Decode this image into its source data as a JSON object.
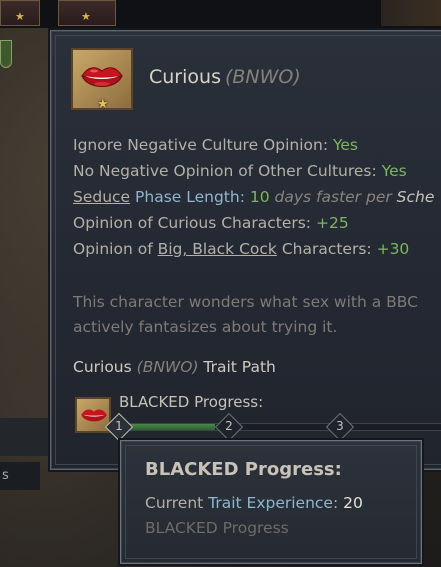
{
  "background": {
    "side_chip_text": "s"
  },
  "trait": {
    "name": "Curious",
    "tag": "(BNWO)",
    "icon": "lips-icon"
  },
  "effects": [
    {
      "label": "Ignore Negative Culture Opinion: ",
      "value": "Yes"
    },
    {
      "label": "No Negative Opinion of Other Cultures: ",
      "value": "Yes"
    }
  ],
  "seduce_line": {
    "link": "Seduce",
    "label": " Phase Length: ",
    "value": "10",
    "tail": " days faster per ",
    "tail2": "Sche"
  },
  "opinion_curious": {
    "label": "Opinion of Curious Characters: ",
    "value": "+25"
  },
  "opinion_bbc": {
    "prefix": "Opinion of ",
    "link": "Big, Black Cock",
    "suffix": " Characters: ",
    "value": "+30"
  },
  "description": {
    "line1": "This character wonders what sex with a BBC",
    "line2": "actively fantasizes about trying it."
  },
  "trait_path": {
    "name": "Curious ",
    "tag": "(BNWO)",
    "suffix": " Trait Path"
  },
  "progress": {
    "label": "BLACKED Progress:",
    "fraction": 0.3,
    "markers": [
      "1",
      "2",
      "3"
    ]
  },
  "tooltip": {
    "title": "BLACKED Progress:",
    "exp_label_a": "Current ",
    "exp_label_b": "Trait Experience",
    "exp_label_c": ": ",
    "exp_value": "20",
    "subtitle": "BLACKED Progress"
  },
  "colors": {
    "positive": "#7ab85e",
    "concept": "#8fb6cf",
    "gold": "#e6c25a"
  }
}
